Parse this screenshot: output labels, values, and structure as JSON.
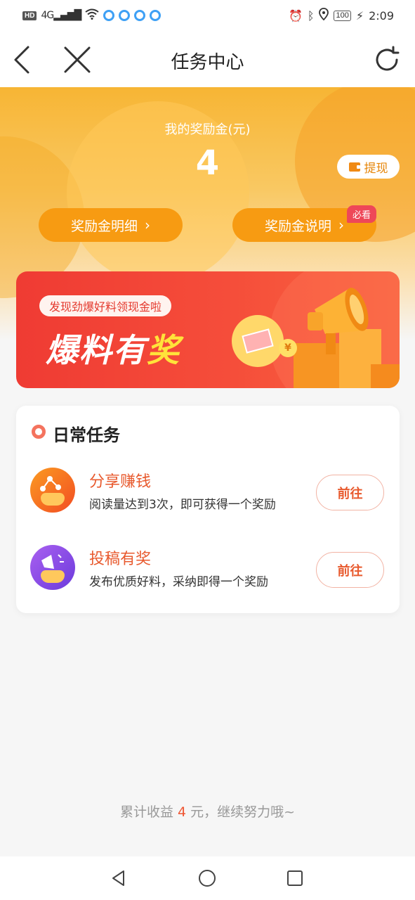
{
  "status_bar": {
    "hd": "HD",
    "network": "4G",
    "battery": "100",
    "time": "2:09"
  },
  "nav": {
    "title": "任务中心",
    "back_icon": "back-arrow-icon",
    "close_icon": "close-icon",
    "refresh_icon": "refresh-icon"
  },
  "rewards": {
    "label": "我的奖励金(元)",
    "amount": "4",
    "withdraw_label": "提现",
    "detail_label": "奖励金明细",
    "explain_label": "奖励金说明",
    "must_read_badge": "必看"
  },
  "banner": {
    "subtitle": "发现劲爆好料领现金啦",
    "title_part1": "爆料有",
    "title_part2": "奖",
    "coin_symbol": "¥"
  },
  "daily_tasks": {
    "heading": "日常任务",
    "items": [
      {
        "title": "分享赚钱",
        "desc": "阅读量达到3次，即可获得一个奖励",
        "button": "前往",
        "icon": "share-icon"
      },
      {
        "title": "投稿有奖",
        "desc": "发布优质好料，采纳即得一个奖励",
        "button": "前往",
        "icon": "megaphone-icon"
      }
    ]
  },
  "footer": {
    "prefix": "累计收益 ",
    "amount": "4",
    "suffix": " 元，继续努力哦~"
  },
  "colors": {
    "accent_orange": "#f79b12",
    "accent_red": "#e85a2e",
    "banner_red": "#ef3b33"
  }
}
